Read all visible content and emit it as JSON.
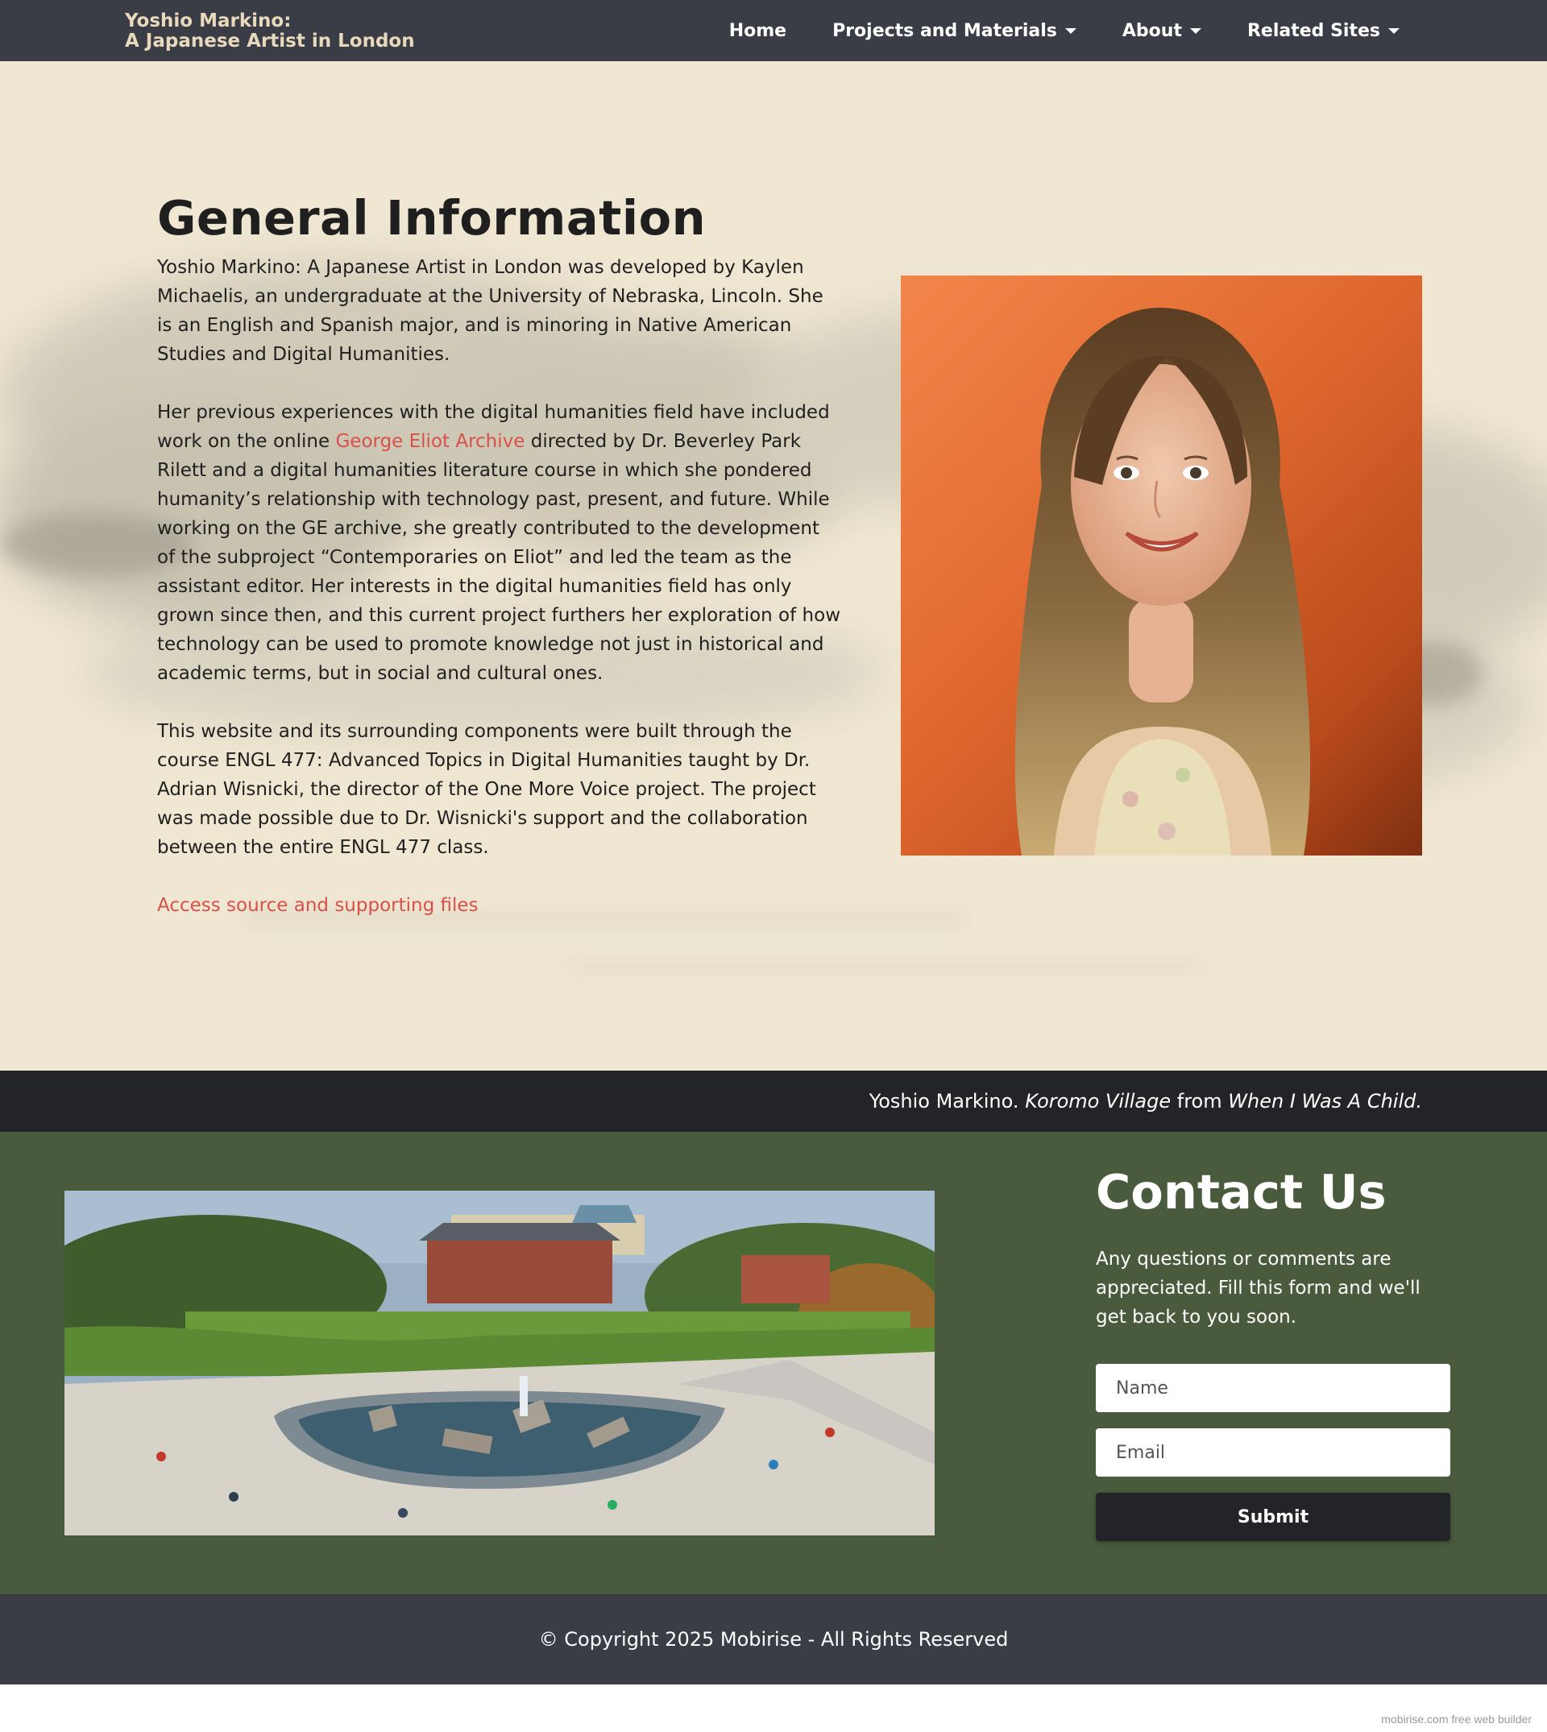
{
  "navbar": {
    "brand_line1": "Yoshio Markino:",
    "brand_line2": "A Japanese Artist in London",
    "items": [
      {
        "label": "Home",
        "dropdown": false
      },
      {
        "label": "Projects and Materials",
        "dropdown": true
      },
      {
        "label": "About",
        "dropdown": true
      },
      {
        "label": "Related Sites",
        "dropdown": true
      }
    ]
  },
  "info": {
    "title": "General Information",
    "para1": "Yoshio Markino: A Japanese Artist in London was developed by Kaylen Michaelis, an undergraduate at the University of Nebraska, Lincoln. She is an English and Spanish major, and is minoring in Native American Studies and Digital Humanities.",
    "para2_before": "Her previous experiences with the digital humanities field have included work on the online ",
    "para2_link": "George Eliot Archive",
    "para2_after": " directed by Dr. Beverley Park Rilett and a digital humanities literature course in which she pondered humanity’s relationship with technology past, present, and future. While working on the GE archive, she greatly contributed to the development of the subproject “Contemporaries on Eliot” and led the team as the assistant editor. Her interests in the digital humanities field has only grown since then, and this current project furthers her exploration of how technology can be used to promote knowledge not just in historical and academic terms, but in social and cultural ones.",
    "para3": "This website and its surrounding components were built through the course ENGL 477: Advanced Topics in Digital Humanities taught by Dr. Adrian Wisnicki, the director of the One More Voice project. The project was made possible due to Dr. Wisnicki's support and the collaboration between the entire ENGL 477 class.",
    "access_link": "Access source and supporting files"
  },
  "caption": {
    "artist": "Yoshio Markino.",
    "work": "Koromo Village",
    "from": "from",
    "book": "When I Was A Child."
  },
  "contact": {
    "title": "Contact Us",
    "description": "Any questions or comments are appreciated. Fill this form and we'll get back to you soon.",
    "name_placeholder": "Name",
    "email_placeholder": "Email",
    "submit_label": "Submit"
  },
  "footer": {
    "copyright": "© Copyright 2025 Mobirise - All Rights Reserved",
    "builder": "mobirise.com free web builder"
  },
  "colors": {
    "nav_bg": "#3a3d46",
    "brand": "#e8d9bd",
    "page_bg": "#efe7d2",
    "link": "#d9504a",
    "caption_bg": "#232427",
    "contact_bg": "#4a5a3c"
  }
}
